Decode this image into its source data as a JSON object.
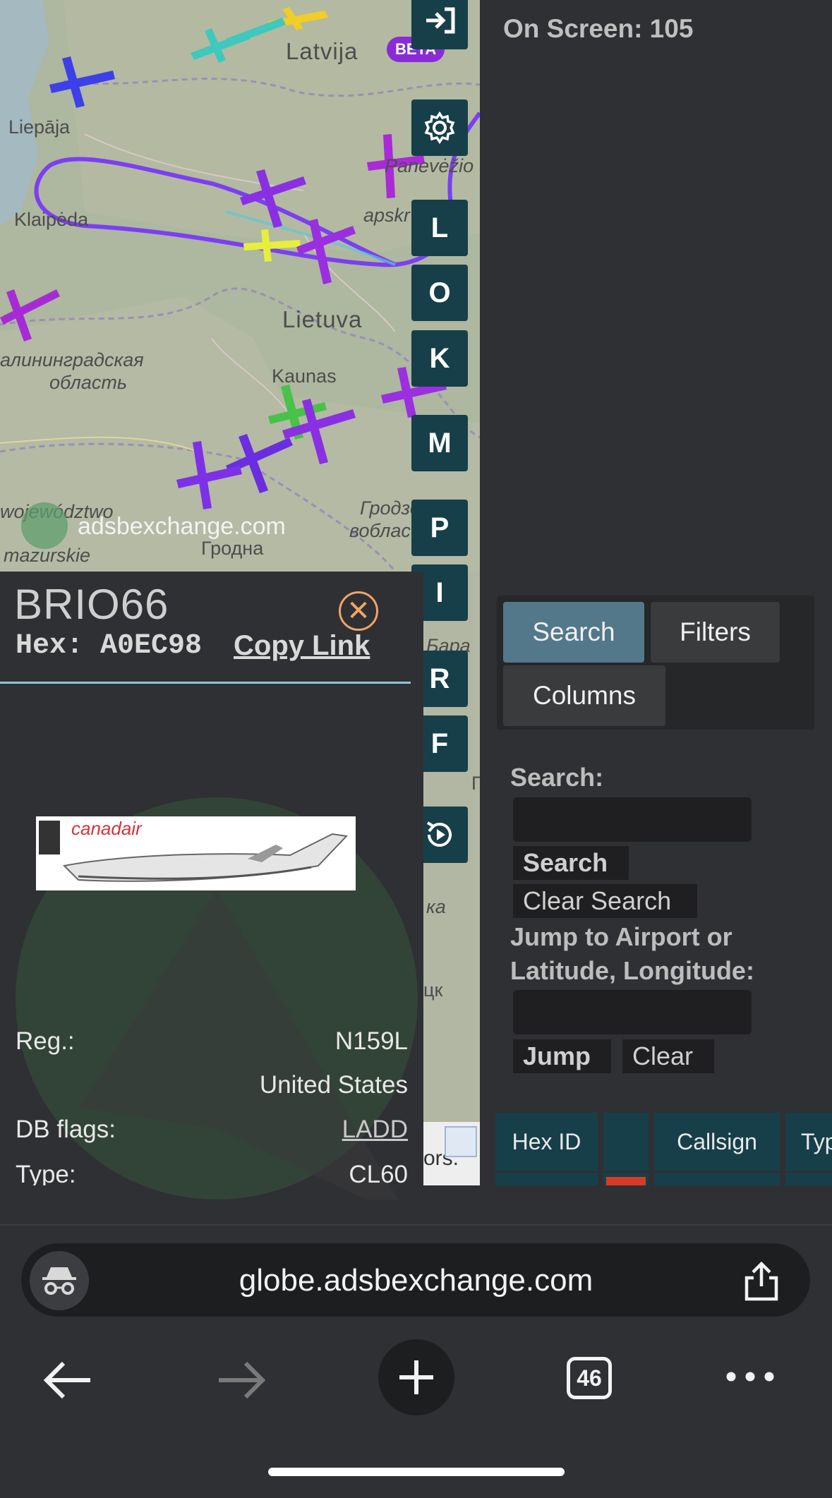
{
  "map": {
    "labels": {
      "latvija": "Latvija",
      "liepaja": "Liepāja",
      "klaipeda": "Klaipėda",
      "lietuva": "Lietuva",
      "panevezio": "Panevėžio",
      "apskr": "apskr",
      "kaunas": "Kaunas",
      "kaliningrad_1": "алининградская",
      "kaliningrad_2": "область",
      "woj_1": "województwo",
      "woj_2": "mazurskie",
      "grodno": "Гродна",
      "grodno_obl_1": "Гродзен",
      "grodno_obl_2": "вобласц",
      "bara": "Бара",
      "ka": "ка",
      "ck": "цк",
      "p": "П",
      "ors": "ors."
    },
    "watermark": "adsbexchange.com",
    "beta_badge": "BETA"
  },
  "sidebar": {
    "buttons": [
      "L",
      "O",
      "K",
      "M",
      "P",
      "I",
      "R",
      "F"
    ]
  },
  "details": {
    "callsign": "BRIO66",
    "hex_label": "Hex: A0EC98",
    "copy_link": "Copy Link",
    "photo_text": "canadair",
    "rows": {
      "reg_label": "Reg.:",
      "reg_value": "N159L",
      "country": "United States",
      "dbflags_label": "DB flags:",
      "dbflags_value": "LADD",
      "type_label": "Type:",
      "type_value": "CL60"
    }
  },
  "right_panel": {
    "on_screen": "On Screen: 105",
    "tabs": [
      "Search",
      "Filters",
      "Columns"
    ],
    "search_label": "Search:",
    "search_button": "Search",
    "clear_search_button": "Clear Search",
    "jump_label_1": "Jump to Airport or",
    "jump_label_2": "Latitude, Longitude:",
    "jump_button": "Jump",
    "clear_button": "Clear",
    "table_headers": [
      "Hex ID",
      "",
      "Callsign",
      "Typ"
    ]
  },
  "browser": {
    "url": "globe.adsbexchange.com",
    "tab_count": "46"
  }
}
